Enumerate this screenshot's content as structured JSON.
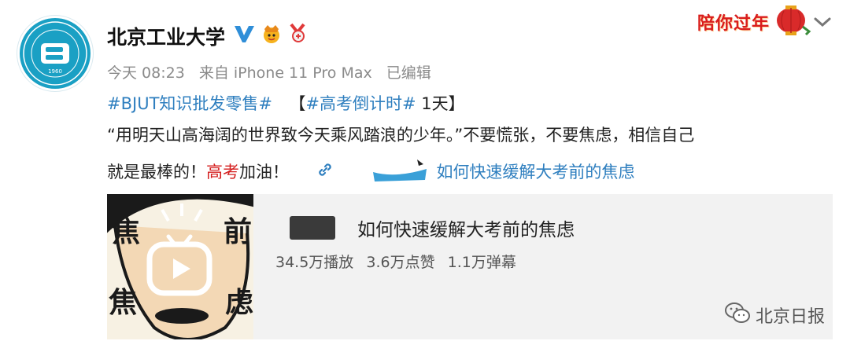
{
  "post": {
    "author": "北京工业大学",
    "timestamp": "今天 08:23",
    "source": "来自 iPhone 11 Pro Max",
    "edited": "已编辑",
    "festival_badge": "陪你过年",
    "topic1": "#BJUT知识批发零售#",
    "bracket_open": "【",
    "topic2": "#高考倒计时#",
    "countdown": "1天】",
    "quote_line": "“用明天山高海阔的世界致今天乘风踏浪的少年。”不要慌张，不要焦虑，相信自己",
    "line3_prefix": "就是最棒的！",
    "line3_red": "高考",
    "line3_suffix": "加油！",
    "link_text": "如何快速缓解大考前的焦虑"
  },
  "card": {
    "title": "如何快速缓解大考前的焦虑",
    "plays": "34.5万播放",
    "likes": "3.6万点赞",
    "danmaku": "1.1万弹幕"
  },
  "watermark": "北京日报",
  "icons": {
    "verified": "verified-v-icon",
    "vip": "vip-crown-icon",
    "medal": "medal-icon",
    "chevron": "chevron-down-icon",
    "link": "link-icon",
    "play": "video-play-icon",
    "wechat": "wechat-icon"
  },
  "colors": {
    "topic": "#2f7fbf",
    "highlight": "#d41d1d",
    "avatar": "#1aa0c4"
  }
}
